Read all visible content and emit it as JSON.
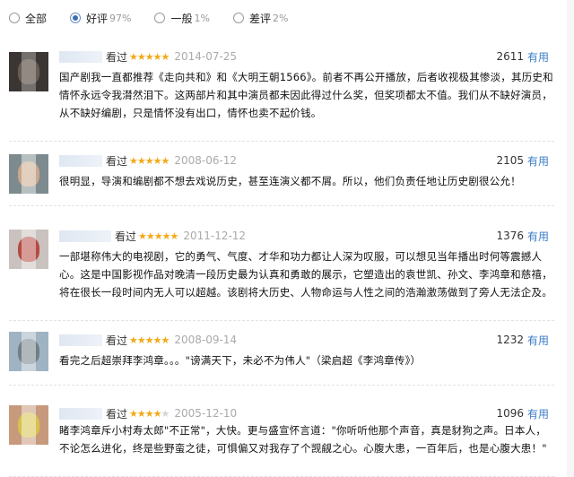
{
  "filters": [
    {
      "label": "全部",
      "pct": "",
      "checked": false
    },
    {
      "label": "好评",
      "pct": "97%",
      "checked": true
    },
    {
      "label": "一般",
      "pct": "1%",
      "checked": false
    },
    {
      "label": "差评",
      "pct": "2%",
      "checked": false
    }
  ],
  "useful_label": "有用",
  "reviews": [
    {
      "seen_label": "看过",
      "stars": 5,
      "star_text": "★★★★★",
      "date": "2014-07-25",
      "votes": "2611",
      "text": "国产剧我一直都推荐《走向共和》和《大明王朝1566》。前者不再公开播放，后者收视极其惨淡，其历史和情怀永远令我潸然泪下。这两部片和其中演员都未因此得过什么奖，但奖项都太不值。我们从不缺好演员，从不缺好编剧，只是情怀没有出口，情怀也卖不起价钱。"
    },
    {
      "seen_label": "看过",
      "stars": 5,
      "star_text": "★★★★★",
      "date": "2008-06-12",
      "votes": "2105",
      "text": "很明显，导演和编剧都不想去戏说历史，甚至连演义都不屑。所以，他们负责任地让历史剧很公允！"
    },
    {
      "seen_label": "看过",
      "stars": 5,
      "star_text": "★★★★★",
      "date": "2011-12-12",
      "votes": "1376",
      "text": "一部堪称伟大的电视剧，它的勇气、气度、才华和功力都让人深为叹服，可以想见当年播出时何等震撼人心。这是中国影视作品对晚清一段历史最为认真和勇敢的展示，它塑造出的袁世凯、孙文、李鸿章和慈禧，将在很长一段时间内无人可以超越。该剧将大历史、人物命运与人性之间的浩瀚激荡做到了旁人无法企及。"
    },
    {
      "seen_label": "看过",
      "stars": 5,
      "star_text": "★★★★★",
      "date": "2008-09-14",
      "votes": "1232",
      "text": "看完之后超崇拜李鸿章。。。\"谤满天下，未必不为伟人\"（梁启超《李鸿章传》）"
    },
    {
      "seen_label": "看过",
      "stars": 4,
      "star_text": "★★★★",
      "star_empty_text": "★",
      "date": "2005-12-10",
      "votes": "1096",
      "text": "睹李鸿章斥小村寿太郎\"不正常\"，大快。更与盛宣怀言道：\"你听听他那个声音，真是豺狗之声。日本人，不论怎么进化，终是些野蛮之徒，可惧偏又对我存了个觊觎之心。心腹大患，一百年后，也是心腹大患！\""
    }
  ],
  "colors": {
    "star": "#f2a917",
    "useful_link": "#3a7cc4",
    "date": "#aaaaaa",
    "radio_checked": "#3a6db3"
  }
}
